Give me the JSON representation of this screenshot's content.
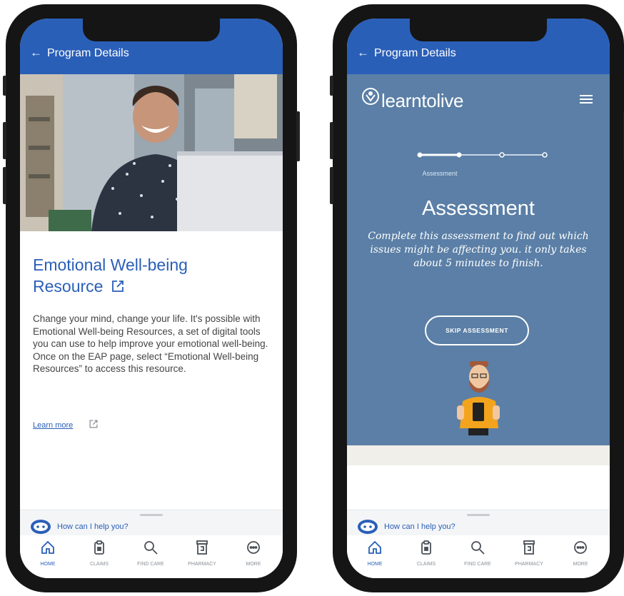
{
  "left_phone": {
    "header": {
      "back_icon": "arrow-left-icon",
      "title": "Program Details"
    },
    "content": {
      "title": "Emotional Well-being Resource",
      "body": "Change your mind, change your life. It's possible with Emotional Well-being Resources, a set of digital tools you can use to help improve your emotional well-being. Once on the EAP page, select “Emotional Well-being Resources” to access this resource.",
      "link": "Learn more"
    },
    "help": {
      "text": "How can I help you?"
    },
    "tabs": [
      {
        "label": "HOME",
        "icon": "home-icon",
        "active": true
      },
      {
        "label": "CLAIMS",
        "icon": "clipboard-icon",
        "active": false
      },
      {
        "label": "FIND CARE",
        "icon": "search-icon",
        "active": false
      },
      {
        "label": "PHARMACY",
        "icon": "pill-bottle-icon",
        "active": false
      },
      {
        "label": "MORE",
        "icon": "more-icon",
        "active": false
      }
    ]
  },
  "right_phone": {
    "header": {
      "back_icon": "arrow-left-icon",
      "title": "Program Details"
    },
    "learntolive": {
      "logo": "learntolive",
      "step_label": "Assessment",
      "progress_fraction": 0.33,
      "heading": "Assessment",
      "description": "Complete this assessment to find out which issues might be affecting you. it only takes about 5 minutes to finish.",
      "skip_button": "SKIP ASSESSMENT"
    },
    "help": {
      "text": "How can I help you?"
    },
    "tabs": [
      {
        "label": "HOME",
        "icon": "home-icon",
        "active": true
      },
      {
        "label": "CLAIMS",
        "icon": "clipboard-icon",
        "active": false
      },
      {
        "label": "FIND CARE",
        "icon": "search-icon",
        "active": false
      },
      {
        "label": "PHARMACY",
        "icon": "pill-bottle-icon",
        "active": false
      },
      {
        "label": "MORE",
        "icon": "more-icon",
        "active": false
      }
    ]
  },
  "colors": {
    "brand_blue": "#2a5fb8",
    "learntolive_bg": "#5b7fa6",
    "text_gray": "#444444",
    "tab_inactive": "#8a8f96"
  }
}
